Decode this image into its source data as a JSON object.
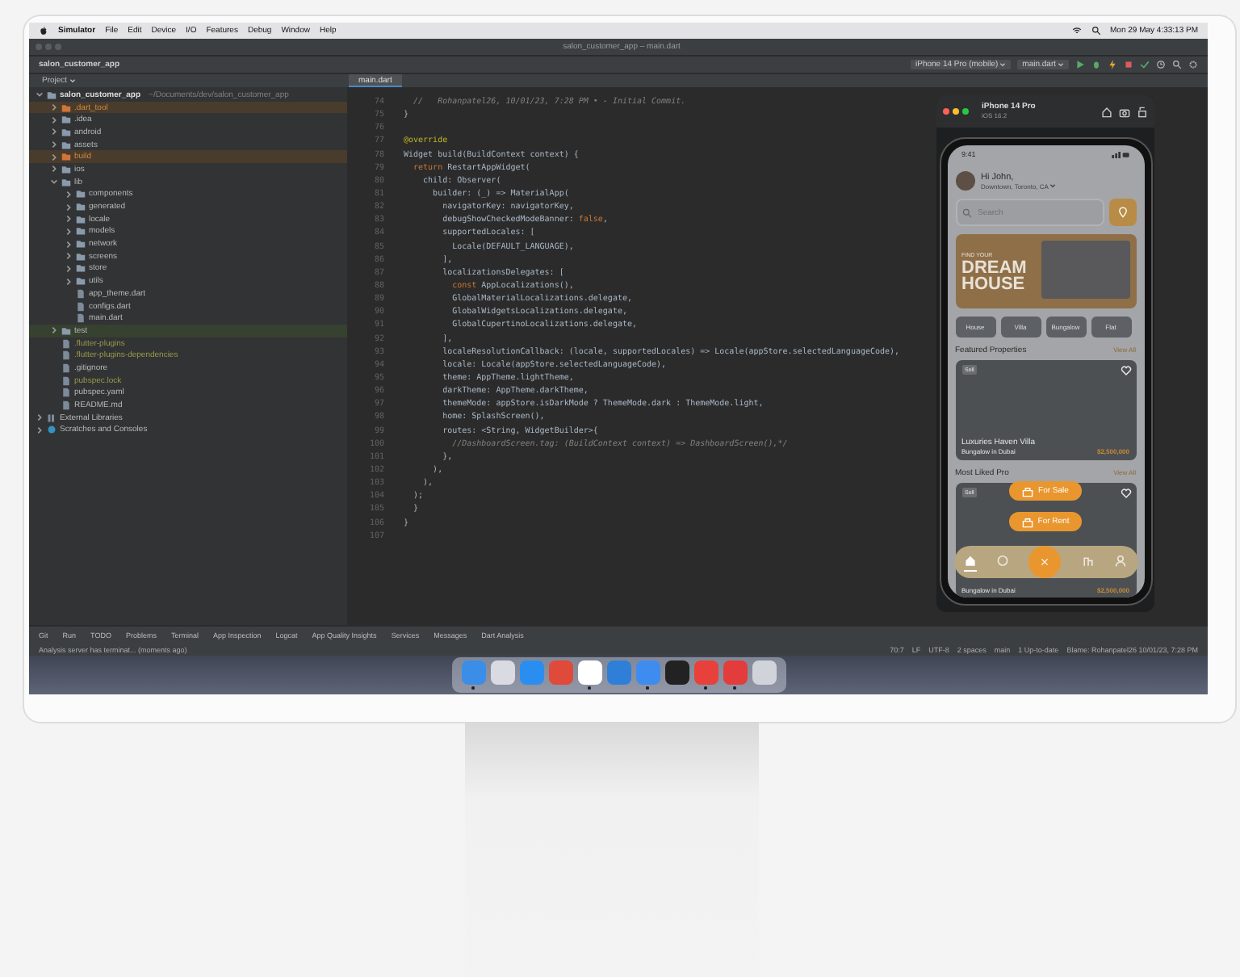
{
  "menu_bar": {
    "app": "Simulator",
    "items": [
      "File",
      "Edit",
      "Device",
      "I/O",
      "Features",
      "Debug",
      "Window",
      "Help"
    ],
    "clock": "Mon 29 May  4:33:13 PM"
  },
  "ide": {
    "title": "salon_customer_app – main.dart",
    "project": "salon_customer_app",
    "device": "iPhone 14 Pro (mobile)",
    "run_config": "main.dart"
  },
  "project_panel": {
    "title": "Project",
    "tree": [
      {
        "label": "salon_customer_app",
        "path": "~/Documents/dev/salon_customer_app",
        "kind": "module",
        "excluded": false,
        "ignored": false,
        "test": false,
        "expanded": true,
        "children": [
          {
            "label": ".dart_tool",
            "kind": "folder",
            "excluded": true,
            "ignored": false,
            "test": false,
            "expanded": false
          },
          {
            "label": ".idea",
            "kind": "folder",
            "excluded": false,
            "ignored": false,
            "test": false,
            "expanded": false
          },
          {
            "label": "android",
            "kind": "folder",
            "excluded": false,
            "ignored": false,
            "test": false,
            "expanded": false
          },
          {
            "label": "assets",
            "kind": "folder",
            "excluded": false,
            "ignored": false,
            "test": false,
            "expanded": false
          },
          {
            "label": "build",
            "kind": "folder",
            "excluded": true,
            "ignored": false,
            "test": false,
            "expanded": false
          },
          {
            "label": "ios",
            "kind": "folder",
            "excluded": false,
            "ignored": false,
            "test": false,
            "expanded": false
          },
          {
            "label": "lib",
            "kind": "folder",
            "excluded": false,
            "ignored": false,
            "test": false,
            "expanded": true,
            "children": [
              {
                "label": "components",
                "kind": "folder",
                "excluded": false,
                "ignored": false,
                "test": false,
                "expanded": false
              },
              {
                "label": "generated",
                "kind": "folder",
                "excluded": false,
                "ignored": false,
                "test": false,
                "expanded": false
              },
              {
                "label": "locale",
                "kind": "folder",
                "excluded": false,
                "ignored": false,
                "test": false,
                "expanded": false
              },
              {
                "label": "models",
                "kind": "folder",
                "excluded": false,
                "ignored": false,
                "test": false,
                "expanded": false
              },
              {
                "label": "network",
                "kind": "folder",
                "excluded": false,
                "ignored": false,
                "test": false,
                "expanded": false
              },
              {
                "label": "screens",
                "kind": "folder",
                "excluded": false,
                "ignored": false,
                "test": false,
                "expanded": false
              },
              {
                "label": "store",
                "kind": "folder",
                "excluded": false,
                "ignored": false,
                "test": false,
                "expanded": false
              },
              {
                "label": "utils",
                "kind": "folder",
                "excluded": false,
                "ignored": false,
                "test": false,
                "expanded": false
              },
              {
                "label": "app_theme.dart",
                "kind": "file",
                "excluded": false,
                "ignored": false,
                "test": false
              },
              {
                "label": "configs.dart",
                "kind": "file",
                "excluded": false,
                "ignored": false,
                "test": false
              },
              {
                "label": "main.dart",
                "kind": "file",
                "excluded": false,
                "ignored": false,
                "test": false
              }
            ]
          },
          {
            "label": "test",
            "kind": "folder",
            "excluded": false,
            "ignored": false,
            "test": true,
            "expanded": false
          },
          {
            "label": ".flutter-plugins",
            "kind": "file",
            "excluded": false,
            "ignored": true,
            "test": false
          },
          {
            "label": ".flutter-plugins-dependencies",
            "kind": "file",
            "excluded": false,
            "ignored": true,
            "test": false
          },
          {
            "label": ".gitignore",
            "kind": "file",
            "excluded": false,
            "ignored": false,
            "test": false
          },
          {
            "label": "pubspec.lock",
            "kind": "file",
            "excluded": false,
            "ignored": true,
            "test": false
          },
          {
            "label": "pubspec.yaml",
            "kind": "file",
            "excluded": false,
            "ignored": false,
            "test": false
          },
          {
            "label": "README.md",
            "kind": "file",
            "excluded": false,
            "ignored": false,
            "test": false
          }
        ]
      },
      {
        "label": "External Libraries",
        "kind": "library",
        "excluded": false,
        "ignored": false,
        "test": false,
        "expanded": false
      },
      {
        "label": "Scratches and Consoles",
        "kind": "scratch",
        "excluded": false,
        "ignored": false,
        "test": false,
        "expanded": false
      }
    ]
  },
  "editor": {
    "tabs": [
      {
        "label": "main.dart",
        "selected": true
      }
    ],
    "lines": [
      {
        "number": "74",
        "tokens": [
          {
            "text": "  //   Rohanpatel26, 10/01/23, 7:28 PM • - Initial Commit.",
            "kind": "comment"
          }
        ]
      },
      {
        "number": "75",
        "tokens": [
          {
            "text": "}",
            "kind": "plain"
          }
        ]
      },
      {
        "number": "76"
      },
      {
        "number": "77",
        "tokens": [
          {
            "text": "@override",
            "kind": "annotation"
          }
        ]
      },
      {
        "number": "78",
        "tokens": [
          {
            "text": "Widget build(BuildContext context) {",
            "kind": "plain"
          }
        ]
      },
      {
        "number": "79",
        "tokens": [
          {
            "text": "  return",
            "kind": "keyword"
          },
          {
            "text": " RestartAppWidget(",
            "kind": "plain"
          }
        ]
      },
      {
        "number": "80",
        "tokens": [
          {
            "text": "    child: Observer(",
            "kind": "plain"
          }
        ]
      },
      {
        "number": "81",
        "tokens": [
          {
            "text": "      builder: (_) => MaterialApp(",
            "kind": "plain"
          }
        ]
      },
      {
        "number": "82",
        "tokens": [
          {
            "text": "        navigatorKey: navigatorKey,",
            "kind": "plain"
          }
        ]
      },
      {
        "number": "83",
        "tokens": [
          {
            "text": "        debugShowCheckedModeBanner: ",
            "kind": "plain"
          },
          {
            "text": "false",
            "kind": "keyword"
          },
          {
            "text": ",",
            "kind": "plain"
          }
        ]
      },
      {
        "number": "84",
        "tokens": [
          {
            "text": "        supportedLocales: [",
            "kind": "plain"
          }
        ]
      },
      {
        "number": "85",
        "tokens": [
          {
            "text": "          Locale(DEFAULT_LANGUAGE),",
            "kind": "plain"
          }
        ]
      },
      {
        "number": "86",
        "tokens": [
          {
            "text": "        ],",
            "kind": "plain"
          }
        ]
      },
      {
        "number": "87",
        "tokens": [
          {
            "text": "        localizationsDelegates: [",
            "kind": "plain"
          }
        ]
      },
      {
        "number": "88",
        "tokens": [
          {
            "text": "          const",
            "kind": "keyword"
          },
          {
            "text": " AppLocalizations(),",
            "kind": "plain"
          }
        ]
      },
      {
        "number": "89",
        "tokens": [
          {
            "text": "          GlobalMaterialLocalizations.delegate,",
            "kind": "plain"
          }
        ]
      },
      {
        "number": "90",
        "tokens": [
          {
            "text": "          GlobalWidgetsLocalizations.delegate,",
            "kind": "plain"
          }
        ]
      },
      {
        "number": "91",
        "tokens": [
          {
            "text": "          GlobalCupertinoLocalizations.delegate,",
            "kind": "plain"
          }
        ]
      },
      {
        "number": "92",
        "tokens": [
          {
            "text": "        ],",
            "kind": "plain"
          }
        ]
      },
      {
        "number": "93",
        "tokens": [
          {
            "text": "        localeResolutionCallback: (locale, supportedLocales) => Locale(appStore.selectedLanguageCode),",
            "kind": "plain"
          }
        ]
      },
      {
        "number": "94",
        "tokens": [
          {
            "text": "        locale: Locale(appStore.selectedLanguageCode),",
            "kind": "plain"
          }
        ]
      },
      {
        "number": "95",
        "tokens": [
          {
            "text": "        theme: AppTheme.lightTheme,",
            "kind": "plain"
          }
        ]
      },
      {
        "number": "96",
        "tokens": [
          {
            "text": "        darkTheme: AppTheme.darkTheme,",
            "kind": "plain"
          }
        ]
      },
      {
        "number": "97",
        "tokens": [
          {
            "text": "        themeMode: appStore.isDarkMode ? ThemeMode.dark : ThemeMode.light,",
            "kind": "plain"
          }
        ]
      },
      {
        "number": "98",
        "tokens": [
          {
            "text": "        home: SplashScreen(),",
            "kind": "plain"
          }
        ]
      },
      {
        "number": "99",
        "tokens": [
          {
            "text": "        routes: <String, WidgetBuilder>{",
            "kind": "plain"
          }
        ]
      },
      {
        "number": "100",
        "tokens": [
          {
            "text": "          //DashboardScreen.tag: (BuildContext context) => DashboardScreen(),*/",
            "kind": "comment"
          }
        ]
      },
      {
        "number": "101",
        "tokens": [
          {
            "text": "        },",
            "kind": "plain"
          }
        ]
      },
      {
        "number": "102",
        "tokens": [
          {
            "text": "      ),",
            "kind": "plain"
          }
        ]
      },
      {
        "number": "103",
        "tokens": [
          {
            "text": "    ),",
            "kind": "plain"
          }
        ]
      },
      {
        "number": "104",
        "tokens": [
          {
            "text": "  );",
            "kind": "plain"
          }
        ]
      },
      {
        "number": "105",
        "tokens": [
          {
            "text": "  }",
            "kind": "plain"
          }
        ]
      },
      {
        "number": "106",
        "tokens": [
          {
            "text": "}",
            "kind": "plain"
          }
        ]
      },
      {
        "number": "107"
      }
    ]
  },
  "simulator": {
    "device": "iPhone 14 Pro",
    "os": "iOS 16.2",
    "app": {
      "time": "9:41",
      "greeting": "Hi John,",
      "location": "Downtown, Toronto, CA",
      "search_placeholder": "Search",
      "banner": {
        "kicker": "FIND YOUR",
        "headline": "DREAM HOUSE"
      },
      "categories": [
        {
          "label": "House"
        },
        {
          "label": "Villa"
        },
        {
          "label": "Bungalow"
        },
        {
          "label": "Flat"
        }
      ],
      "sections": [
        {
          "title": "Featured Properties",
          "link": "View All",
          "cards": [
            {
              "tag": "Sell",
              "title": "Luxuries Haven Villa",
              "subtitle": "Bungalow in Dubai",
              "price": "$2,500,000"
            }
          ]
        },
        {
          "title": "Most Liked Pro",
          "link": "View All",
          "cards": [
            {
              "tag": "Sell",
              "subtitle": "Bungalow in Dubai",
              "price": "$2,500,000"
            }
          ]
        }
      ],
      "actions": [
        "For Sale",
        "For Rent"
      ],
      "nav": [
        {
          "kind": "home",
          "selected": true
        },
        {
          "kind": "chat",
          "selected": false
        },
        {
          "kind": "close",
          "selected": false
        },
        {
          "kind": "building",
          "selected": false
        },
        {
          "kind": "person",
          "selected": false
        }
      ]
    }
  },
  "tool_tabs": [
    "Git",
    "Run",
    "TODO",
    "Problems",
    "Terminal",
    "App Inspection",
    "Logcat",
    "App Quality Insights",
    "Services",
    "Messages",
    "Dart Analysis"
  ],
  "status_bar": {
    "message": "Analysis server has terminat... (moments ago)",
    "items": [
      "70:7",
      "LF",
      "UTF-8",
      "2 spaces",
      "main",
      "1 Up-to-date",
      "Blame: Rohanpatel26 10/01/23, 7:28 PM"
    ]
  },
  "dock": [
    {
      "color": "#3b8ee8",
      "running": true
    },
    {
      "color": "#d9dae2",
      "running": false
    },
    {
      "color": "#2a8ef0",
      "running": false
    },
    {
      "color": "#e04a3a",
      "running": false
    },
    {
      "color": "#ffffff",
      "running": true
    },
    {
      "color": "#2f7fd8",
      "running": false
    },
    {
      "color": "#3e8cf0",
      "running": true
    },
    {
      "color": "#222222",
      "running": false
    },
    {
      "color": "#e8403a",
      "running": true
    },
    {
      "color": "#e23c3c",
      "running": true
    },
    {
      "color": "#d0d4da",
      "running": false
    }
  ]
}
